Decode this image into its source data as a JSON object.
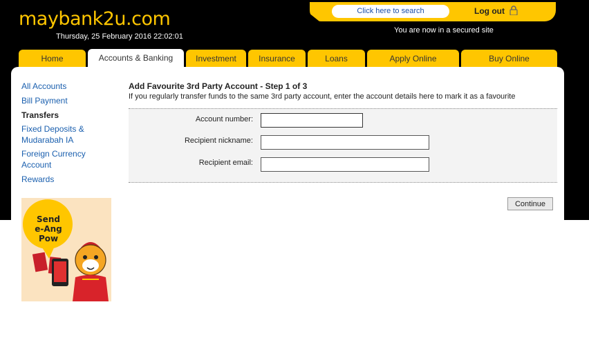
{
  "header": {
    "logo": "maybank2u.com",
    "datetime": "Thursday, 25 February 2016 22:02:01",
    "search_label": "Click here to search",
    "logout_label": "Log out",
    "secured_text": "You are now in a secured site"
  },
  "nav": {
    "tabs": [
      {
        "label": "Home"
      },
      {
        "label": "Accounts & Banking",
        "active": true
      },
      {
        "label": "Investment"
      },
      {
        "label": "Insurance"
      },
      {
        "label": "Loans"
      },
      {
        "label": "Apply Online"
      },
      {
        "label": "Buy Online"
      }
    ]
  },
  "sidebar": {
    "items": [
      {
        "label": "All Accounts"
      },
      {
        "label": "Bill Payment"
      },
      {
        "label": "Transfers",
        "current": true
      },
      {
        "label": "Fixed Deposits & Mudarabah IA"
      },
      {
        "label": "Foreign Currency Account"
      },
      {
        "label": "Rewards"
      }
    ]
  },
  "promo": {
    "line1": "Send",
    "line2": "e-Ang Pow"
  },
  "form": {
    "title": "Add Favourite 3rd Party Account - Step 1 of 3",
    "description": "If you regularly transfer funds to the same 3rd party account, enter the account details here to mark it as a favourite",
    "fields": [
      {
        "label": "Account number:",
        "value": ""
      },
      {
        "label": "Recipient nickname:",
        "value": ""
      },
      {
        "label": "Recipient email:",
        "value": ""
      }
    ],
    "continue_label": "Continue"
  },
  "colors": {
    "brand_yellow": "#ffc600",
    "header_black": "#000000",
    "link_blue": "#1a5fae"
  }
}
